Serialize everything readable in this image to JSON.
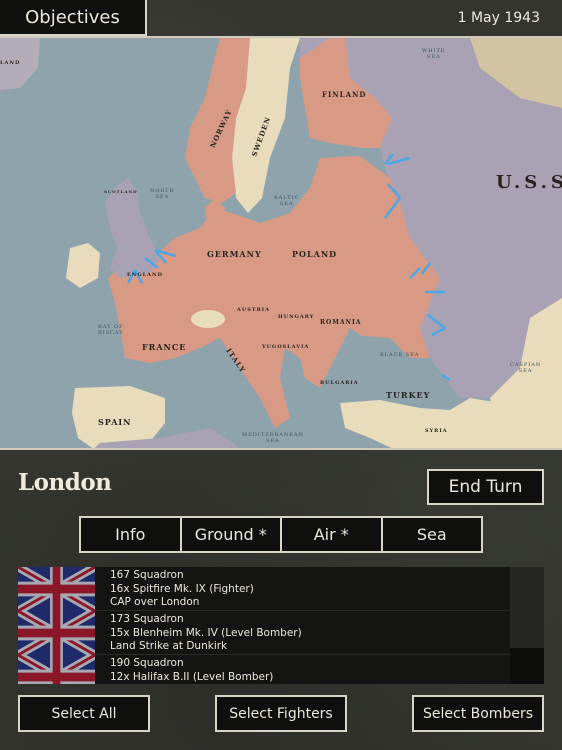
{
  "topbar": {
    "objectives_label": "Objectives",
    "date": "1 May 1943"
  },
  "map": {
    "colors": {
      "sea": "#8fa3ad",
      "axis": "#d89a84",
      "allies": "#a9a2b4",
      "neutral": "#e8dcbc",
      "attack_arrow": "#4aa8e8",
      "axis_city": "#c81818",
      "allied_unit": "#3a8ad8"
    },
    "country_labels": [
      {
        "text": "GERMANY",
        "size": 8
      },
      {
        "text": "POLAND",
        "size": 8
      },
      {
        "text": "FRANCE",
        "size": 8
      },
      {
        "text": "FINLAND",
        "size": 7
      },
      {
        "text": "NORWAY",
        "size": 7
      },
      {
        "text": "SWEDEN",
        "size": 7
      },
      {
        "text": "SPAIN",
        "size": 8
      },
      {
        "text": "TURKEY",
        "size": 8
      },
      {
        "text": "ROMANIA",
        "size": 6
      },
      {
        "text": "HUNGARY",
        "size": 5
      },
      {
        "text": "AUSTRIA",
        "size": 5
      },
      {
        "text": "YUGOSLAVIA",
        "size": 5
      },
      {
        "text": "BULGARIA",
        "size": 5
      },
      {
        "text": "ITALY",
        "size": 7
      },
      {
        "text": "ENGLAND",
        "size": 5
      },
      {
        "text": "SCOTLAND",
        "size": 4
      },
      {
        "text": "SYRIA",
        "size": 5
      },
      {
        "text": "U.S.S",
        "size": 18
      },
      {
        "text": "LAND",
        "size": 5
      }
    ],
    "sea_labels": [
      {
        "text": "NORTH\nSEA"
      },
      {
        "text": "BALTIC\nSEA"
      },
      {
        "text": "BLACK SEA"
      },
      {
        "text": "BAY OF\nBISCAY"
      },
      {
        "text": "MEDITERRANEAN\nSEA"
      },
      {
        "text": "WHITE\nSEA"
      },
      {
        "text": "CASPIAN\nSEA"
      }
    ]
  },
  "panel": {
    "city_name": "London",
    "end_turn_label": "End Turn",
    "tabs": [
      {
        "label": "Info"
      },
      {
        "label": "Ground *"
      },
      {
        "label": "Air *"
      },
      {
        "label": "Sea"
      }
    ],
    "units": [
      {
        "name": "167 Squadron",
        "aircraft": "16x Spitfire Mk. IX (Fighter)",
        "mission": "CAP over London",
        "flag": "union-jack"
      },
      {
        "name": "173 Squadron",
        "aircraft": "15x Blenheim Mk. IV (Level Bomber)",
        "mission": "Land Strike at Dunkirk",
        "flag": "union-jack"
      },
      {
        "name": "190 Squadron",
        "aircraft": "12x Halifax B.II (Level Bomber)",
        "mission": "",
        "flag": "union-jack"
      }
    ],
    "scroll_position": 0,
    "buttons": {
      "select_all": "Select All",
      "select_fighters": "Select Fighters",
      "select_bombers": "Select Bombers"
    }
  }
}
